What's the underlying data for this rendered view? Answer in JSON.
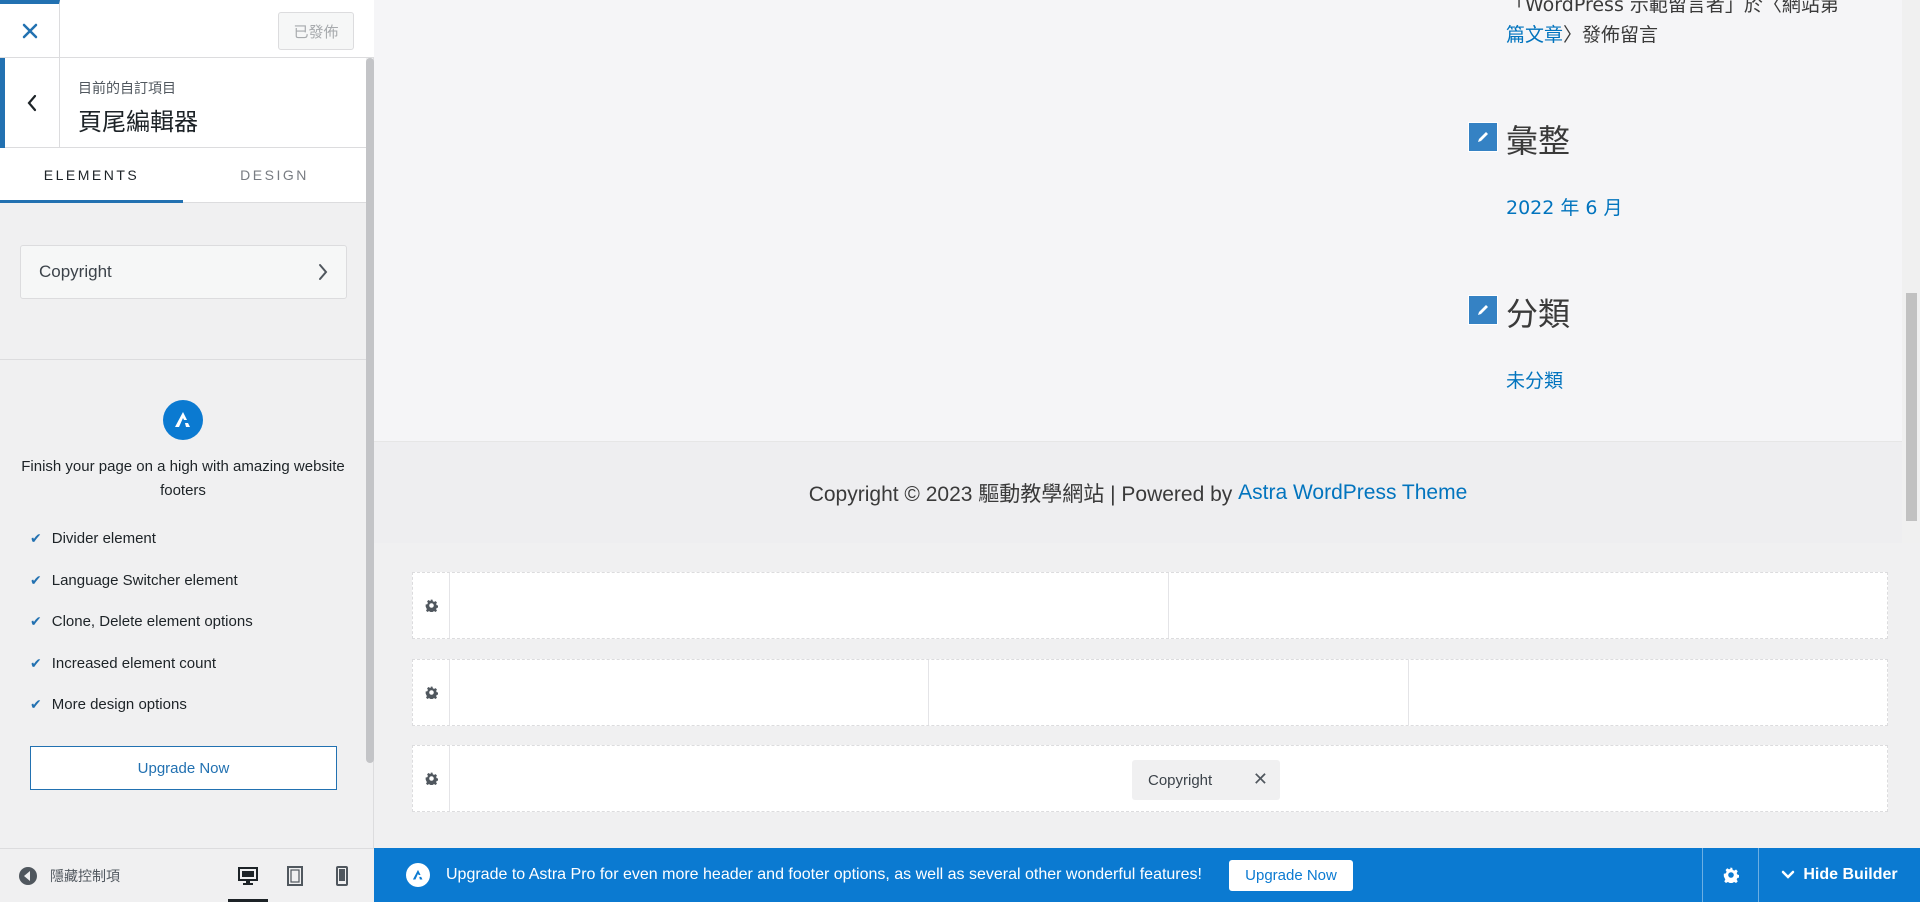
{
  "header": {
    "publish_label": "已發佈"
  },
  "section": {
    "crumb": "目前的自訂項目",
    "title": "頁尾編輯器"
  },
  "tabs": [
    {
      "label": "ELEMENTS",
      "active": true
    },
    {
      "label": "DESIGN",
      "active": false
    }
  ],
  "elements": {
    "copyright_label": "Copyright"
  },
  "upsell": {
    "text": "Finish your page on a high with amazing website footers",
    "features": [
      "Divider element",
      "Language Switcher element",
      "Clone, Delete element options",
      "Increased element count",
      "More design options"
    ],
    "button_label": "Upgrade Now"
  },
  "panel_footer": {
    "hide_controls_label": "隱藏控制項",
    "devices": [
      "desktop",
      "tablet",
      "mobile"
    ],
    "active_device": "desktop"
  },
  "preview": {
    "widget_top_prefix": "「WordPress 示範留言者」於〈網站第",
    "widget_top_link": "篇文章",
    "widget_top_suffix": "〉發佈留言",
    "archive_title": "彙整",
    "archive_link": "2022 年 6 月",
    "category_title": "分類",
    "category_link": "未分類",
    "footer_text": "Copyright © 2023 驅動教學網站 | Powered by ",
    "footer_link": "Astra WordPress Theme"
  },
  "builder": {
    "chip_label": "Copyright"
  },
  "bottom_bar": {
    "text": "Upgrade to Astra Pro for even more header and footer options, as well as several other wonderful features!",
    "upgrade_label": "Upgrade Now",
    "hide_label": "Hide Builder"
  },
  "colors": {
    "accent": "#2271b1",
    "astra_blue": "#0b7ad1",
    "link": "#0274be"
  }
}
